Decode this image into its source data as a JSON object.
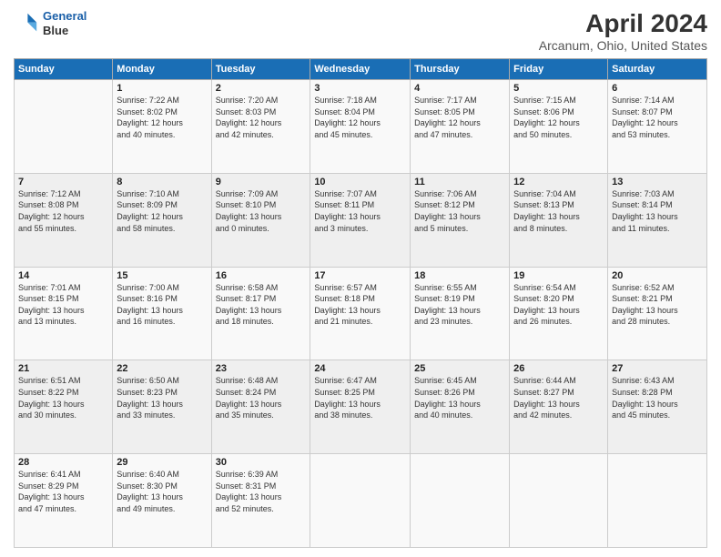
{
  "header": {
    "logo_line1": "General",
    "logo_line2": "Blue",
    "title": "April 2024",
    "subtitle": "Arcanum, Ohio, United States"
  },
  "days_of_week": [
    "Sunday",
    "Monday",
    "Tuesday",
    "Wednesday",
    "Thursday",
    "Friday",
    "Saturday"
  ],
  "weeks": [
    [
      {
        "day": "",
        "info": ""
      },
      {
        "day": "1",
        "info": "Sunrise: 7:22 AM\nSunset: 8:02 PM\nDaylight: 12 hours\nand 40 minutes."
      },
      {
        "day": "2",
        "info": "Sunrise: 7:20 AM\nSunset: 8:03 PM\nDaylight: 12 hours\nand 42 minutes."
      },
      {
        "day": "3",
        "info": "Sunrise: 7:18 AM\nSunset: 8:04 PM\nDaylight: 12 hours\nand 45 minutes."
      },
      {
        "day": "4",
        "info": "Sunrise: 7:17 AM\nSunset: 8:05 PM\nDaylight: 12 hours\nand 47 minutes."
      },
      {
        "day": "5",
        "info": "Sunrise: 7:15 AM\nSunset: 8:06 PM\nDaylight: 12 hours\nand 50 minutes."
      },
      {
        "day": "6",
        "info": "Sunrise: 7:14 AM\nSunset: 8:07 PM\nDaylight: 12 hours\nand 53 minutes."
      }
    ],
    [
      {
        "day": "7",
        "info": "Sunrise: 7:12 AM\nSunset: 8:08 PM\nDaylight: 12 hours\nand 55 minutes."
      },
      {
        "day": "8",
        "info": "Sunrise: 7:10 AM\nSunset: 8:09 PM\nDaylight: 12 hours\nand 58 minutes."
      },
      {
        "day": "9",
        "info": "Sunrise: 7:09 AM\nSunset: 8:10 PM\nDaylight: 13 hours\nand 0 minutes."
      },
      {
        "day": "10",
        "info": "Sunrise: 7:07 AM\nSunset: 8:11 PM\nDaylight: 13 hours\nand 3 minutes."
      },
      {
        "day": "11",
        "info": "Sunrise: 7:06 AM\nSunset: 8:12 PM\nDaylight: 13 hours\nand 5 minutes."
      },
      {
        "day": "12",
        "info": "Sunrise: 7:04 AM\nSunset: 8:13 PM\nDaylight: 13 hours\nand 8 minutes."
      },
      {
        "day": "13",
        "info": "Sunrise: 7:03 AM\nSunset: 8:14 PM\nDaylight: 13 hours\nand 11 minutes."
      }
    ],
    [
      {
        "day": "14",
        "info": "Sunrise: 7:01 AM\nSunset: 8:15 PM\nDaylight: 13 hours\nand 13 minutes."
      },
      {
        "day": "15",
        "info": "Sunrise: 7:00 AM\nSunset: 8:16 PM\nDaylight: 13 hours\nand 16 minutes."
      },
      {
        "day": "16",
        "info": "Sunrise: 6:58 AM\nSunset: 8:17 PM\nDaylight: 13 hours\nand 18 minutes."
      },
      {
        "day": "17",
        "info": "Sunrise: 6:57 AM\nSunset: 8:18 PM\nDaylight: 13 hours\nand 21 minutes."
      },
      {
        "day": "18",
        "info": "Sunrise: 6:55 AM\nSunset: 8:19 PM\nDaylight: 13 hours\nand 23 minutes."
      },
      {
        "day": "19",
        "info": "Sunrise: 6:54 AM\nSunset: 8:20 PM\nDaylight: 13 hours\nand 26 minutes."
      },
      {
        "day": "20",
        "info": "Sunrise: 6:52 AM\nSunset: 8:21 PM\nDaylight: 13 hours\nand 28 minutes."
      }
    ],
    [
      {
        "day": "21",
        "info": "Sunrise: 6:51 AM\nSunset: 8:22 PM\nDaylight: 13 hours\nand 30 minutes."
      },
      {
        "day": "22",
        "info": "Sunrise: 6:50 AM\nSunset: 8:23 PM\nDaylight: 13 hours\nand 33 minutes."
      },
      {
        "day": "23",
        "info": "Sunrise: 6:48 AM\nSunset: 8:24 PM\nDaylight: 13 hours\nand 35 minutes."
      },
      {
        "day": "24",
        "info": "Sunrise: 6:47 AM\nSunset: 8:25 PM\nDaylight: 13 hours\nand 38 minutes."
      },
      {
        "day": "25",
        "info": "Sunrise: 6:45 AM\nSunset: 8:26 PM\nDaylight: 13 hours\nand 40 minutes."
      },
      {
        "day": "26",
        "info": "Sunrise: 6:44 AM\nSunset: 8:27 PM\nDaylight: 13 hours\nand 42 minutes."
      },
      {
        "day": "27",
        "info": "Sunrise: 6:43 AM\nSunset: 8:28 PM\nDaylight: 13 hours\nand 45 minutes."
      }
    ],
    [
      {
        "day": "28",
        "info": "Sunrise: 6:41 AM\nSunset: 8:29 PM\nDaylight: 13 hours\nand 47 minutes."
      },
      {
        "day": "29",
        "info": "Sunrise: 6:40 AM\nSunset: 8:30 PM\nDaylight: 13 hours\nand 49 minutes."
      },
      {
        "day": "30",
        "info": "Sunrise: 6:39 AM\nSunset: 8:31 PM\nDaylight: 13 hours\nand 52 minutes."
      },
      {
        "day": "",
        "info": ""
      },
      {
        "day": "",
        "info": ""
      },
      {
        "day": "",
        "info": ""
      },
      {
        "day": "",
        "info": ""
      }
    ]
  ]
}
